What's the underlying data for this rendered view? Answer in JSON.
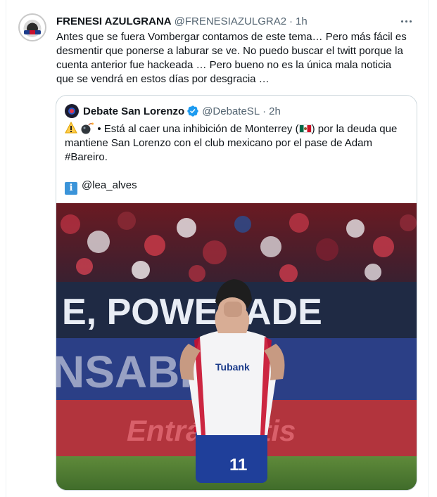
{
  "tweet": {
    "author_name": "FRENESI AZULGRANA",
    "author_handle": "@FRENESIAZULGRA2",
    "separator": "·",
    "time": "1h",
    "body_lines": [
      "Antes que se fuera Vombergar contamos de este tema… Pero más fácil es",
      "desmentir que ponerse a laburar se ve. No puedo buscar el twitt porque la",
      "cuenta  anterior fue hackeada … Pero bueno no es la única mala noticia",
      "que se vendrá en estos días por desgracia …"
    ]
  },
  "quote": {
    "author_name": "Debate San Lorenzo",
    "author_handle": "@DebateSL",
    "separator": "·",
    "time": "2h",
    "line1_main": " • Está al caer una inhibición de Monterrey (",
    "line1_tail": ") por la deuda que",
    "line2": "mantiene San Lorenzo con el club mexicano por el pase de Adam",
    "line3": "#Bareiro.",
    "credit": "@lea_alves",
    "info_glyph": "i"
  },
  "media": {
    "banner_top": "E, POWERADE",
    "banner_mid": "NSABRIN",
    "banner_bottom": "Entrá Gratis",
    "sponsor": "Tubank",
    "shirt_number": "11"
  },
  "colors": {
    "name_text": "#0f1419",
    "secondary_text": "#536471",
    "verified_blue": "#1d9bf0",
    "border": "#cfd9de",
    "san_lorenzo_red": "#c8102e",
    "san_lorenzo_blue": "#1b3b8a"
  },
  "icons": {
    "more": "more-dots-icon",
    "verified": "verified-badge-icon",
    "warning": "warning-emoji",
    "bomb": "bomb-emoji",
    "flag": "mexico-flag-emoji",
    "info": "information-emoji"
  }
}
